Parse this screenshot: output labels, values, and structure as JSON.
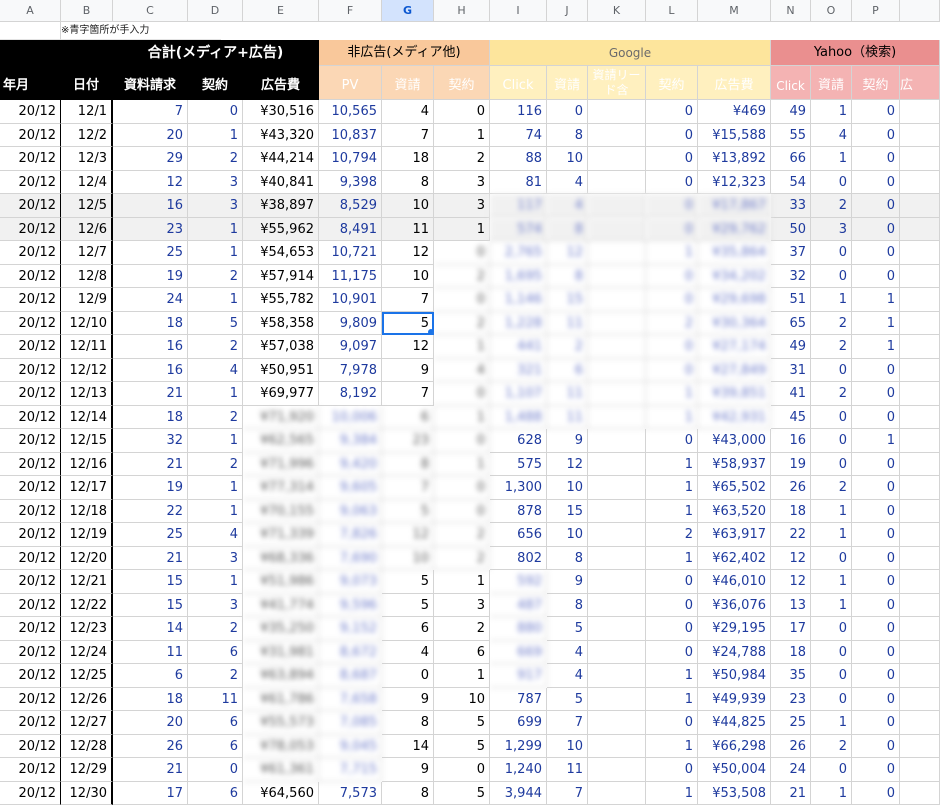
{
  "columns": [
    "A",
    "B",
    "C",
    "D",
    "E",
    "F",
    "G",
    "H",
    "I",
    "J",
    "K",
    "L",
    "M",
    "N",
    "O",
    "P"
  ],
  "selected_column": "G",
  "note": "※青字箇所が手入力",
  "groups": {
    "total": "合計(メディア+広告)",
    "nonad": "非広告(メディア他)",
    "google": "Google",
    "yahoo": "Yahoo（検索)"
  },
  "headers": {
    "year_month": "年月",
    "date": "日付",
    "shiryo_seikyu": "資料請求",
    "keiyaku": "契約",
    "kokokuhi": "広告費",
    "pv": "PV",
    "shisei": "資請",
    "keiyaku2": "契約",
    "click": "Click",
    "shisei2": "資請",
    "lead": "資請リード含",
    "keiyaku3": "契約",
    "kokokuhi2": "広告費",
    "click2": "Click",
    "shisei3": "資請",
    "keiyaku4": "契約",
    "truncated": "広"
  },
  "rows": [
    {
      "ym": "20/12",
      "d": "12/1",
      "c": "7",
      "dd": "0",
      "e": "¥30,516",
      "f": "10,565",
      "g": "4",
      "h": "0",
      "i": "116",
      "j": "0",
      "k": "",
      "l": "0",
      "m": "¥469",
      "n": "49",
      "o": "1",
      "p": "0"
    },
    {
      "ym": "20/12",
      "d": "12/2",
      "c": "20",
      "dd": "1",
      "e": "¥43,320",
      "f": "10,837",
      "g": "7",
      "h": "1",
      "i": "74",
      "j": "8",
      "k": "",
      "l": "0",
      "m": "¥15,588",
      "n": "55",
      "o": "4",
      "p": "0"
    },
    {
      "ym": "20/12",
      "d": "12/3",
      "c": "29",
      "dd": "2",
      "e": "¥44,214",
      "f": "10,794",
      "g": "18",
      "h": "2",
      "i": "88",
      "j": "10",
      "k": "",
      "l": "0",
      "m": "¥13,892",
      "n": "66",
      "o": "1",
      "p": "0"
    },
    {
      "ym": "20/12",
      "d": "12/4",
      "c": "12",
      "dd": "3",
      "e": "¥40,841",
      "f": "9,398",
      "g": "8",
      "h": "3",
      "i": "81",
      "j": "4",
      "k": "",
      "l": "0",
      "m": "¥12,323",
      "n": "54",
      "o": "0",
      "p": "0"
    },
    {
      "ym": "20/12",
      "d": "12/5",
      "c": "16",
      "dd": "3",
      "e": "¥38,897",
      "f": "8,529",
      "g": "10",
      "h": "3",
      "i": "117",
      "j": "4",
      "k": "",
      "l": "0",
      "m": "¥17,867",
      "n": "33",
      "o": "2",
      "p": "0"
    },
    {
      "ym": "20/12",
      "d": "12/6",
      "c": "23",
      "dd": "1",
      "e": "¥55,962",
      "f": "8,491",
      "g": "11",
      "h": "1",
      "i": "574",
      "j": "8",
      "k": "",
      "l": "0",
      "m": "¥29,762",
      "n": "50",
      "o": "3",
      "p": "0"
    },
    {
      "ym": "20/12",
      "d": "12/7",
      "c": "25",
      "dd": "1",
      "e": "¥54,653",
      "f": "10,721",
      "g": "12",
      "h": "0",
      "i": "2,765",
      "j": "12",
      "k": "",
      "l": "1",
      "m": "¥35,864",
      "n": "37",
      "o": "0",
      "p": "0"
    },
    {
      "ym": "20/12",
      "d": "12/8",
      "c": "19",
      "dd": "2",
      "e": "¥57,914",
      "f": "11,175",
      "g": "10",
      "h": "2",
      "i": "1,695",
      "j": "8",
      "k": "",
      "l": "0",
      "m": "¥34,202",
      "n": "32",
      "o": "0",
      "p": "0"
    },
    {
      "ym": "20/12",
      "d": "12/9",
      "c": "24",
      "dd": "1",
      "e": "¥55,782",
      "f": "10,901",
      "g": "7",
      "h": "0",
      "i": "1,146",
      "j": "15",
      "k": "",
      "l": "0",
      "m": "¥29,698",
      "n": "51",
      "o": "1",
      "p": "1"
    },
    {
      "ym": "20/12",
      "d": "12/10",
      "c": "18",
      "dd": "5",
      "e": "¥58,358",
      "f": "9,809",
      "g": "5",
      "h": "2",
      "i": "1,228",
      "j": "11",
      "k": "",
      "l": "2",
      "m": "¥30,364",
      "n": "65",
      "o": "2",
      "p": "1"
    },
    {
      "ym": "20/12",
      "d": "12/11",
      "c": "16",
      "dd": "2",
      "e": "¥57,038",
      "f": "9,097",
      "g": "12",
      "h": "1",
      "i": "441",
      "j": "2",
      "k": "",
      "l": "0",
      "m": "¥27,174",
      "n": "49",
      "o": "2",
      "p": "1"
    },
    {
      "ym": "20/12",
      "d": "12/12",
      "c": "16",
      "dd": "4",
      "e": "¥50,951",
      "f": "7,978",
      "g": "9",
      "h": "4",
      "i": "321",
      "j": "6",
      "k": "",
      "l": "0",
      "m": "¥27,849",
      "n": "31",
      "o": "0",
      "p": "0"
    },
    {
      "ym": "20/12",
      "d": "12/13",
      "c": "21",
      "dd": "1",
      "e": "¥69,977",
      "f": "8,192",
      "g": "7",
      "h": "0",
      "i": "1,107",
      "j": "11",
      "k": "",
      "l": "1",
      "m": "¥39,851",
      "n": "41",
      "o": "2",
      "p": "0"
    },
    {
      "ym": "20/12",
      "d": "12/14",
      "c": "18",
      "dd": "2",
      "e": "¥71,920",
      "f": "10,006",
      "g": "6",
      "h": "1",
      "i": "1,488",
      "j": "11",
      "k": "",
      "l": "1",
      "m": "¥42,931",
      "n": "45",
      "o": "0",
      "p": "0"
    },
    {
      "ym": "20/12",
      "d": "12/15",
      "c": "32",
      "dd": "1",
      "e": "¥62,565",
      "f": "9,384",
      "g": "23",
      "h": "0",
      "i": "628",
      "j": "9",
      "k": "",
      "l": "0",
      "m": "¥43,000",
      "n": "16",
      "o": "0",
      "p": "1"
    },
    {
      "ym": "20/12",
      "d": "12/16",
      "c": "21",
      "dd": "2",
      "e": "¥71,996",
      "f": "9,420",
      "g": "8",
      "h": "1",
      "i": "575",
      "j": "12",
      "k": "",
      "l": "1",
      "m": "¥58,937",
      "n": "19",
      "o": "0",
      "p": "0"
    },
    {
      "ym": "20/12",
      "d": "12/17",
      "c": "19",
      "dd": "1",
      "e": "¥77,314",
      "f": "9,605",
      "g": "7",
      "h": "0",
      "i": "1,300",
      "j": "10",
      "k": "",
      "l": "1",
      "m": "¥65,502",
      "n": "26",
      "o": "2",
      "p": "0"
    },
    {
      "ym": "20/12",
      "d": "12/18",
      "c": "22",
      "dd": "1",
      "e": "¥70,155",
      "f": "9,063",
      "g": "5",
      "h": "0",
      "i": "878",
      "j": "15",
      "k": "",
      "l": "1",
      "m": "¥63,520",
      "n": "18",
      "o": "1",
      "p": "0"
    },
    {
      "ym": "20/12",
      "d": "12/19",
      "c": "25",
      "dd": "4",
      "e": "¥71,339",
      "f": "7,826",
      "g": "12",
      "h": "2",
      "i": "656",
      "j": "10",
      "k": "",
      "l": "2",
      "m": "¥63,917",
      "n": "22",
      "o": "1",
      "p": "0"
    },
    {
      "ym": "20/12",
      "d": "12/20",
      "c": "21",
      "dd": "3",
      "e": "¥68,336",
      "f": "7,690",
      "g": "10",
      "h": "2",
      "i": "802",
      "j": "8",
      "k": "",
      "l": "1",
      "m": "¥62,402",
      "n": "12",
      "o": "0",
      "p": "0"
    },
    {
      "ym": "20/12",
      "d": "12/21",
      "c": "15",
      "dd": "1",
      "e": "¥51,986",
      "f": "9,073",
      "g": "5",
      "h": "1",
      "i": "592",
      "j": "9",
      "k": "",
      "l": "0",
      "m": "¥46,010",
      "n": "12",
      "o": "1",
      "p": "0"
    },
    {
      "ym": "20/12",
      "d": "12/22",
      "c": "15",
      "dd": "3",
      "e": "¥41,774",
      "f": "9,596",
      "g": "5",
      "h": "3",
      "i": "487",
      "j": "8",
      "k": "",
      "l": "0",
      "m": "¥36,076",
      "n": "13",
      "o": "1",
      "p": "0"
    },
    {
      "ym": "20/12",
      "d": "12/23",
      "c": "14",
      "dd": "2",
      "e": "¥35,250",
      "f": "9,152",
      "g": "6",
      "h": "2",
      "i": "880",
      "j": "5",
      "k": "",
      "l": "0",
      "m": "¥29,195",
      "n": "17",
      "o": "0",
      "p": "0"
    },
    {
      "ym": "20/12",
      "d": "12/24",
      "c": "11",
      "dd": "6",
      "e": "¥31,981",
      "f": "8,672",
      "g": "4",
      "h": "6",
      "i": "669",
      "j": "4",
      "k": "",
      "l": "0",
      "m": "¥24,788",
      "n": "18",
      "o": "0",
      "p": "0"
    },
    {
      "ym": "20/12",
      "d": "12/25",
      "c": "6",
      "dd": "2",
      "e": "¥63,894",
      "f": "8,687",
      "g": "0",
      "h": "1",
      "i": "917",
      "j": "4",
      "k": "",
      "l": "1",
      "m": "¥50,984",
      "n": "35",
      "o": "0",
      "p": "0"
    },
    {
      "ym": "20/12",
      "d": "12/26",
      "c": "18",
      "dd": "11",
      "e": "¥61,786",
      "f": "7,658",
      "g": "9",
      "h": "10",
      "i": "787",
      "j": "5",
      "k": "",
      "l": "1",
      "m": "¥49,939",
      "n": "23",
      "o": "0",
      "p": "0"
    },
    {
      "ym": "20/12",
      "d": "12/27",
      "c": "20",
      "dd": "6",
      "e": "¥55,573",
      "f": "7,085",
      "g": "8",
      "h": "5",
      "i": "699",
      "j": "7",
      "k": "",
      "l": "0",
      "m": "¥44,825",
      "n": "25",
      "o": "1",
      "p": "0"
    },
    {
      "ym": "20/12",
      "d": "12/28",
      "c": "26",
      "dd": "6",
      "e": "¥78,053",
      "f": "9,045",
      "g": "14",
      "h": "5",
      "i": "1,299",
      "j": "10",
      "k": "",
      "l": "1",
      "m": "¥66,298",
      "n": "26",
      "o": "2",
      "p": "0"
    },
    {
      "ym": "20/12",
      "d": "12/29",
      "c": "21",
      "dd": "0",
      "e": "¥61,361",
      "f": "7,715",
      "g": "9",
      "h": "0",
      "i": "1,240",
      "j": "11",
      "k": "",
      "l": "0",
      "m": "¥50,004",
      "n": "24",
      "o": "0",
      "p": "0"
    },
    {
      "ym": "20/12",
      "d": "12/30",
      "c": "17",
      "dd": "6",
      "e": "¥64,560",
      "f": "7,573",
      "g": "8",
      "h": "5",
      "i": "3,944",
      "j": "7",
      "k": "",
      "l": "1",
      "m": "¥53,508",
      "n": "21",
      "o": "1",
      "p": "0"
    }
  ]
}
